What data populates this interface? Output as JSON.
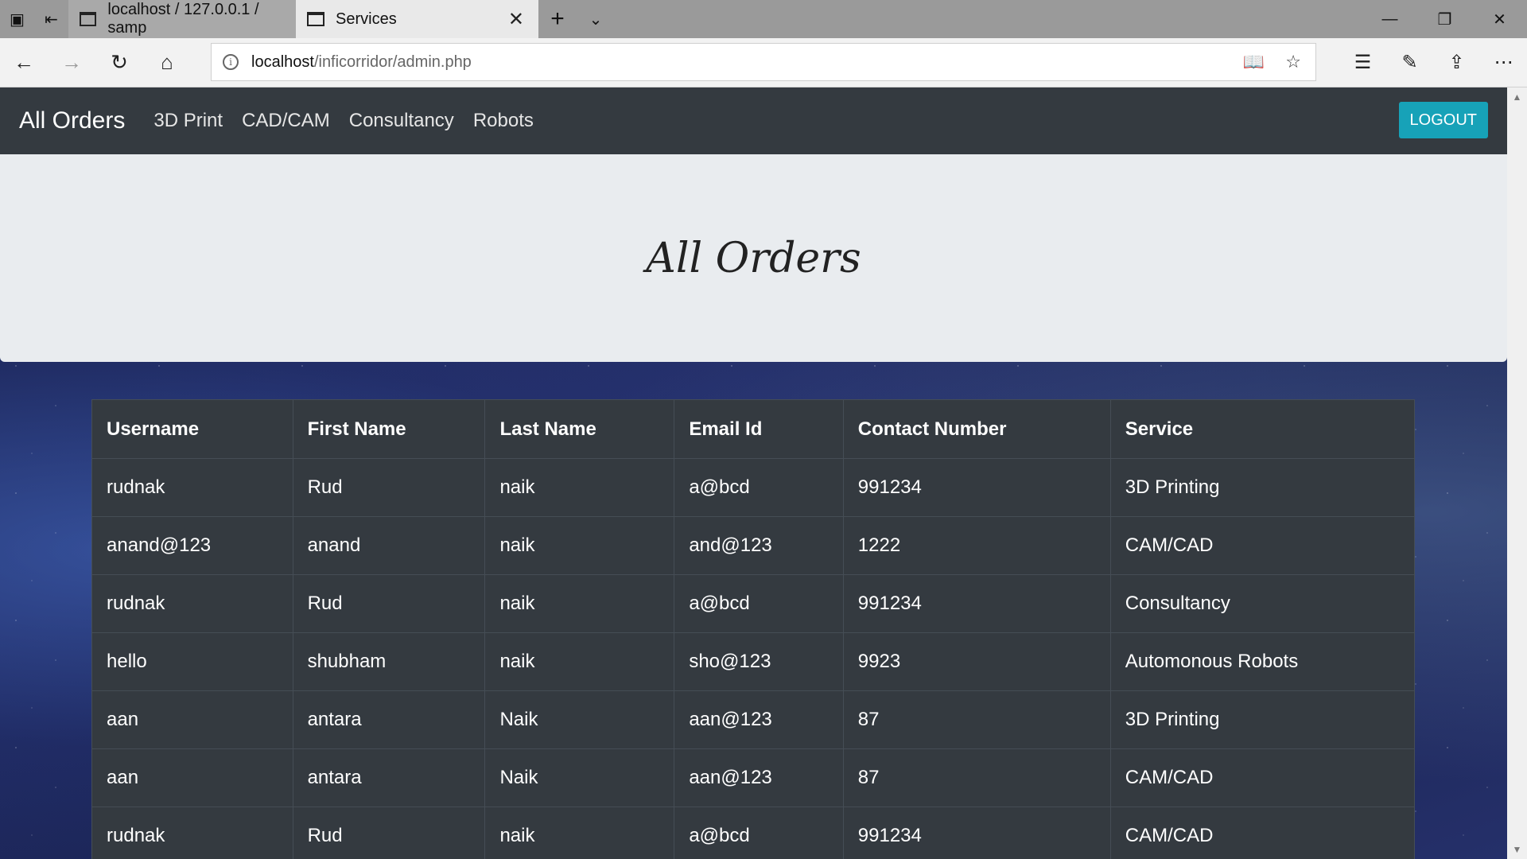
{
  "browser": {
    "tabs": [
      {
        "title": "localhost / 127.0.0.1 / samp",
        "active": false
      },
      {
        "title": "Services",
        "active": true
      }
    ],
    "url_host": "localhost",
    "url_path": "/inficorridor/admin.php"
  },
  "navbar": {
    "brand": "All Orders",
    "links": [
      "3D Print",
      "CAD/CAM",
      "Consultancy",
      "Robots"
    ],
    "logout_label": "LOGOUT"
  },
  "jumbotron": {
    "title": "All Orders"
  },
  "table": {
    "headers": [
      "Username",
      "First Name",
      "Last Name",
      "Email Id",
      "Contact Number",
      "Service"
    ],
    "rows": [
      [
        "rudnak",
        "Rud",
        "naik",
        "a@bcd",
        "991234",
        "3D Printing"
      ],
      [
        "anand@123",
        "anand",
        "naik",
        "and@123",
        "1222",
        "CAM/CAD"
      ],
      [
        "rudnak",
        "Rud",
        "naik",
        "a@bcd",
        "991234",
        "Consultancy"
      ],
      [
        "hello",
        "shubham",
        "naik",
        "sho@123",
        "9923",
        "Automonous Robots"
      ],
      [
        "aan",
        "antara",
        "Naik",
        "aan@123",
        "87",
        "3D Printing"
      ],
      [
        "aan",
        "antara",
        "Naik",
        "aan@123",
        "87",
        "CAM/CAD"
      ],
      [
        "rudnak",
        "Rud",
        "naik",
        "a@bcd",
        "991234",
        "CAM/CAD"
      ]
    ]
  },
  "colors": {
    "navbar_bg": "#343a40",
    "logout_bg": "#17a2b8",
    "jumbotron_bg": "#e9ecef",
    "table_bg": "#343a40"
  }
}
